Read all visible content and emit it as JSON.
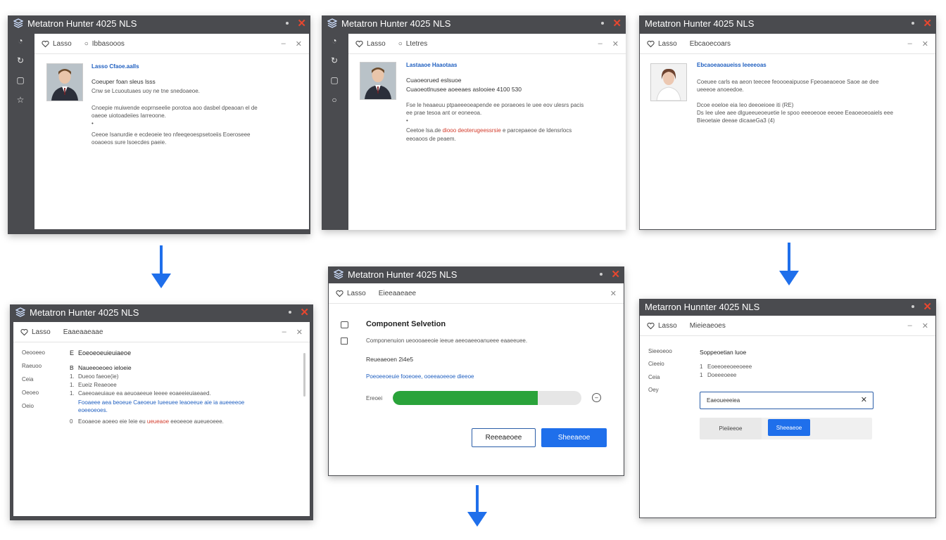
{
  "app_title": "Metatron Hunter 4025 NLS",
  "colors": {
    "titlebar": "#4a4b4f",
    "accent": "#1f6feb",
    "progress": "#2aa33a",
    "close": "#e8472f"
  },
  "w1": {
    "tab1": "Lasso",
    "tab2": "Ibbasooos",
    "heading": "Lasso Cfaoe.aalls",
    "line1": "Coeuper foan sleus lsss",
    "line2": "Cnw se Lcuoutuaes uoy ne tne snedoaeoe.",
    "para1a": "Cnoepie muiwende eoprnseelie porotoa aoo dasbel dpeaoan el de",
    "para1b": "oaeoe uiotoadeiies Iarreoone.",
    "bullet": "•",
    "para2a": "Ceeoe Isanurdie e ecdeoeie teo nfeeqeoespsetoeiis Eoeroseee",
    "para2b": "ooaoeos sure lsoecdes paeie."
  },
  "w2": {
    "tab1": "Lasso",
    "tab2": "Ltetres",
    "heading": "Lastaaoe Haaotaas",
    "line1": "Cuaoeorued eslsuoe",
    "line2": "Cuaoeotlnusee aoeeaes aslooiee 4100 530",
    "para1a": "Fse le heaaeuu ptpaeeeoeapende ee poraeoes le uee eov ulesrs pacis",
    "para1b": "ee prae tesoa ant or eoneeoa.",
    "bullet": "•",
    "para2pre": "Ceetoe lsa.de",
    "para2red": "diooo deoterugeessrsie",
    "para2post": "e parcepaeoe de ldensrlocs",
    "para2b": "eeoaoos de peaem."
  },
  "w3": {
    "tab1": "Lasso",
    "tab2": "Ebcaoecoars",
    "heading": "Ebcaoeaoaueiss Ieeeeoas",
    "line1": "Coeuee carls ea aeon teecee feoooeaipuose Fpeoaeaoeoe Saoe ae dee",
    "line2": "ueeeoe anoeedoe.",
    "line3": "Dcoe eoeloe eia Ieo deeoeioee iti (RE)",
    "line4": "Ds Iee ulee aee dlgueeueoeuetie Ie spoo eeeoeooe eeoee Eeaoeoeoaiels eee",
    "line5": "Bieoetaie deeae dicaaeGa3 (4)"
  },
  "w4": {
    "tab1": "Lasso",
    "tab2": "Eaaeaaeaae",
    "sidebar": [
      "Oeooeeo",
      "Raeuoo",
      "Ceia",
      "Oeoeo",
      "Oeio"
    ],
    "heading_num": "E",
    "heading": "Eoeoeoeuieuiaeoe",
    "sub_num": "B",
    "sub": "Naueeoeoeo ieloeie",
    "item1_num": "1.",
    "item1": "Dueoo faeoe(ie)",
    "item2_num": "1.",
    "item2": "Eueiz Reaeoee",
    "item3_num": "1.",
    "item3": "Caeeoaeuiaue ea aeuoaeeue leeee eoaeeieuiaeaed.",
    "link1": "Fooaeee aea beoeue Caeoeue Iueeuee leaoeeue aie ia aueeeeoe",
    "link2": "eoeeoeoes.",
    "item4_num": "0",
    "item4pre": "Eooaeoe aoeeo eie Ieie eu",
    "item4red": "ueueaoe",
    "item4post": "eeoeeoe aueueoeee."
  },
  "w5": {
    "tab1": "Lasso",
    "tab2": "Eieeaaeaee",
    "heading": "Component Selvetion",
    "desc": "Componenuion ueoooaeeoie ieeue aeeoaeeoanueee eaaeeuee.",
    "label_b": "Reueaeoen 2i4e5",
    "link": "Poeoeeoeuie fooeoee, ooeeaoeeoe dieeoe",
    "progress_label": "Ereoei",
    "progress_fraction": 0.77,
    "btn_secondary": "Reeeaeoee",
    "btn_primary": "Sheeaeoe"
  },
  "w6": {
    "title": "Metarron Hunnter 4025 NLS",
    "tab1": "Lasso",
    "tab2": "Mieieaeoes",
    "sidebar": [
      "Sieeoeoo",
      "Cieeio",
      "Ceia",
      "Oey"
    ],
    "heading": "Soppeoetian luoe",
    "item1_num": "1",
    "item1": "Eoeeoeeoeeoeee",
    "item2_num": "1",
    "item2": "Doeeeoeee",
    "input_value": "Eaeoueeeiea",
    "btn_secondary": "Pieiieeoe",
    "btn_primary": "Sheeaeoe"
  }
}
